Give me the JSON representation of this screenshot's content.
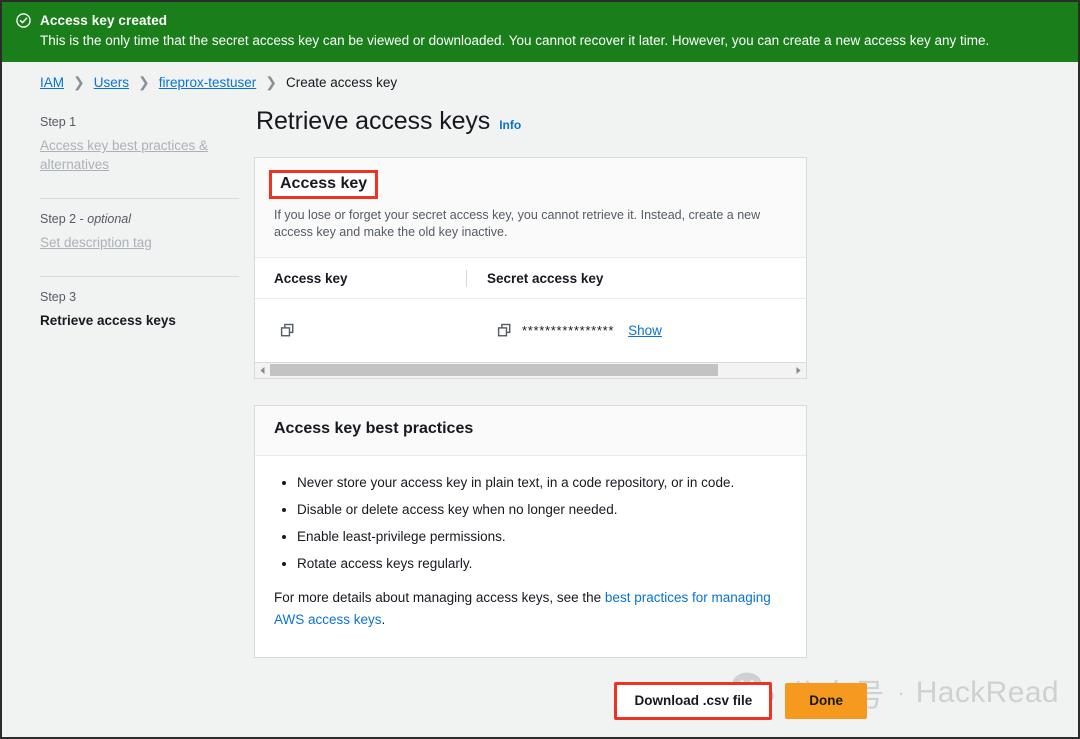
{
  "banner": {
    "icon": "check-circle-icon",
    "title": "Access key created",
    "message": "This is the only time that the secret access key can be viewed or downloaded. You cannot recover it later. However, you can create a new access key any time.",
    "background_color": "#1a7f1b"
  },
  "breadcrumb": {
    "items": [
      {
        "label": "IAM",
        "link": true
      },
      {
        "label": "Users",
        "link": true
      },
      {
        "label": "fireprox-testuser",
        "link": true
      },
      {
        "label": "Create access key",
        "link": false
      }
    ],
    "separator": "❯"
  },
  "sidebar": {
    "steps": [
      {
        "label": "Step 1",
        "optional": "",
        "name": "Access key best practices & alternatives",
        "active": false
      },
      {
        "label": "Step 2 - ",
        "optional": "optional",
        "name": "Set description tag",
        "active": false
      },
      {
        "label": "Step 3",
        "optional": "",
        "name": "Retrieve access keys",
        "active": true
      }
    ]
  },
  "main": {
    "title": "Retrieve access keys",
    "info_label": "Info",
    "access_key_panel": {
      "heading": "Access key",
      "highlighted": true,
      "highlight_color": "#ee3323",
      "description": "If you lose or forget your secret access key, you cannot retrieve it. Instead, create a new access key and make the old key inactive.",
      "columns": [
        "Access key",
        "Secret access key"
      ],
      "row": {
        "access_key_copy_icon": "copy-icon",
        "access_key_value": "",
        "secret_copy_icon": "copy-icon",
        "secret_masked_value": "****************",
        "show_label": "Show"
      },
      "scrollbar": {
        "left_arrow": "chevron-left-icon",
        "right_arrow": "chevron-right-icon",
        "thumb_percent": 86
      }
    },
    "best_practices_panel": {
      "heading": "Access key best practices",
      "bullets": [
        "Never store your access key in plain text, in a code repository, or in code.",
        "Disable or delete access key when no longer needed.",
        "Enable least-privilege permissions.",
        "Rotate access keys regularly."
      ],
      "footer_prefix": "For more details about managing access keys, see the ",
      "footer_link": "best practices for managing AWS access keys",
      "footer_suffix": "."
    }
  },
  "footer": {
    "download_label": "Download .csv file",
    "download_highlighted": true,
    "done_label": "Done",
    "done_color": "#f59a1e"
  },
  "watermark": {
    "icon": "wechat-icon",
    "chinese_text": "公众号",
    "separator": "·",
    "brand": "HackRead"
  }
}
